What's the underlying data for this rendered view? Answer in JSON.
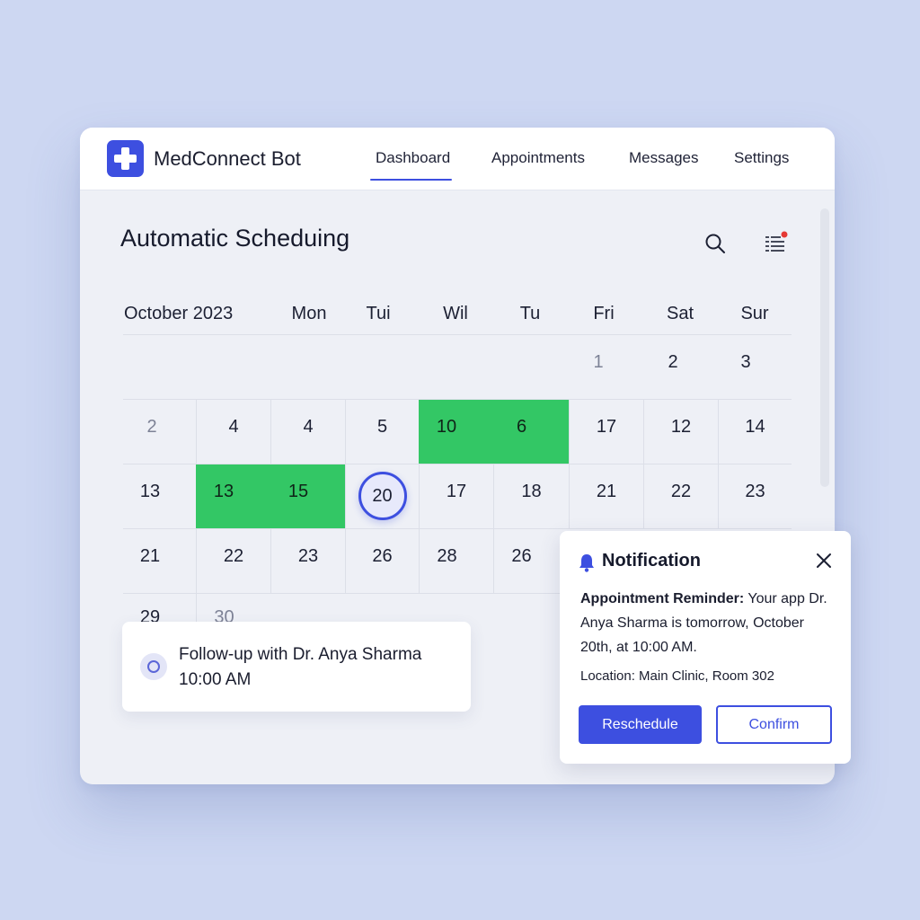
{
  "app": {
    "name": "MedConnect Bot"
  },
  "nav": {
    "items": [
      "Dashboard",
      "Appointments",
      "Messages",
      "Settings"
    ],
    "active": "Dashboard"
  },
  "page": {
    "title": "Automatic Scheduing"
  },
  "icons": {
    "search": "search-icon",
    "menu": "list-menu-icon",
    "bell": "bell-icon",
    "close": "close-icon"
  },
  "colors": {
    "accent": "#3d4fe0",
    "booked": "#33c765",
    "badge": "#e53935"
  },
  "calendar": {
    "month_label": "October 2023",
    "weekdays": [
      "Mon",
      "Tui",
      "Wil",
      "Tu",
      "Fri",
      "Sat",
      "Sur"
    ],
    "rows": [
      [
        "",
        "",
        "",
        "",
        "",
        "1",
        "2",
        "3"
      ],
      [
        "2",
        "4",
        "4",
        "5",
        "10",
        "6",
        "17",
        "12",
        "14"
      ],
      [
        "13",
        "13",
        "15",
        "20",
        "17",
        "18",
        "21",
        "22",
        "23"
      ],
      [
        "21",
        "22",
        "23",
        "26",
        "28",
        "26"
      ],
      [
        "29",
        "30"
      ]
    ],
    "selected": "20"
  },
  "followup": {
    "title": "Follow-up with Dr. Anya Sharma",
    "time": "10:00 AM"
  },
  "notification": {
    "title": "Notification",
    "reminder_label": "Appointment Reminder:",
    "reminder_text": " Your app Dr. Anya Sharma is tomorrow, October 20th, at 10:00 AM.",
    "location": "Location: Main Clinic, Room 302",
    "reschedule_label": "Reschedule",
    "confirm_label": "Confirm"
  }
}
